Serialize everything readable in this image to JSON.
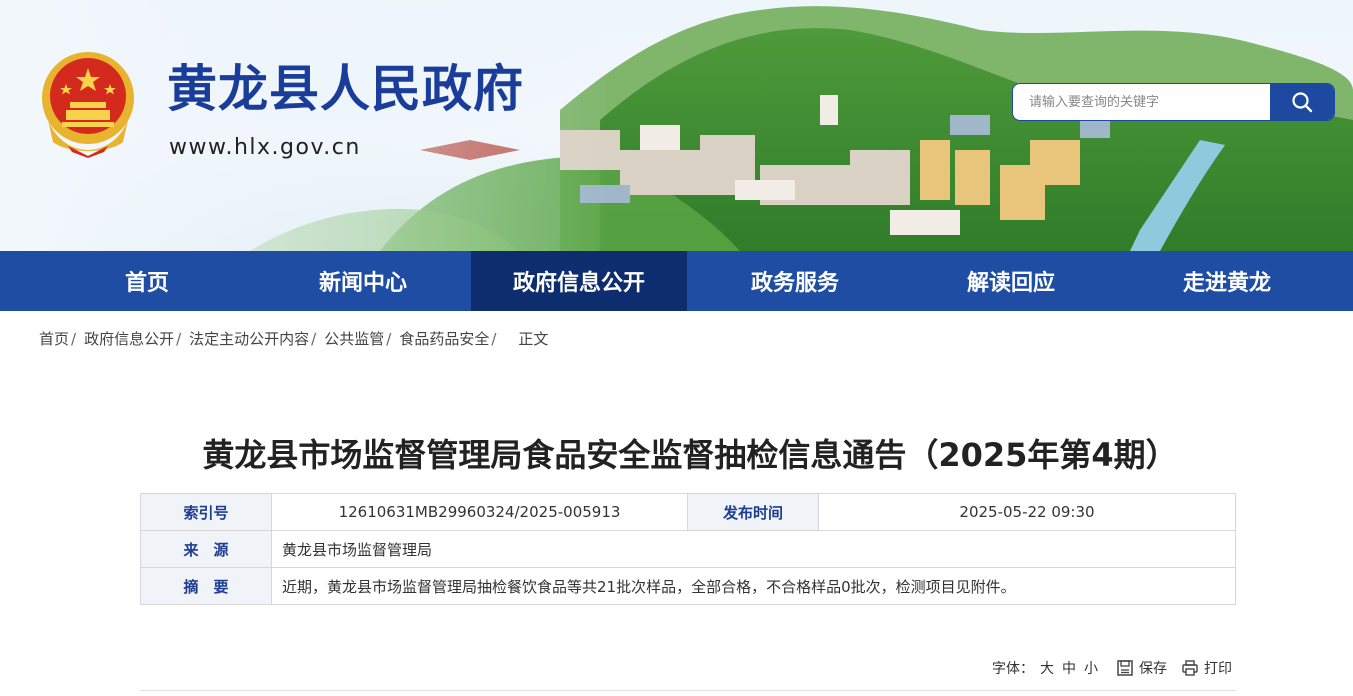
{
  "header": {
    "site_title": "黄龙县人民政府",
    "site_url": "www.hlx.gov.cn",
    "search_placeholder": "请输入要查询的关键字"
  },
  "nav": {
    "items": [
      {
        "label": "首页"
      },
      {
        "label": "新闻中心"
      },
      {
        "label": "政府信息公开"
      },
      {
        "label": "政务服务"
      },
      {
        "label": "解读回应"
      },
      {
        "label": "走进黄龙"
      }
    ],
    "active_index": 2
  },
  "breadcrumb": {
    "items": [
      "首页",
      "政府信息公开",
      "法定主动公开内容",
      "公共监管",
      "食品药品安全"
    ],
    "current": "正文",
    "separator": "/"
  },
  "article": {
    "title": "黄龙县市场监督管理局食品安全监督抽检信息通告（2025年第4期）",
    "meta": {
      "index_label": "索引号",
      "index_value": "12610631MB29960324/2025-005913",
      "date_label": "发布时间",
      "date_value": "2025-05-22 09:30",
      "source_label": "来　源",
      "source_value": "黄龙县市场监督管理局",
      "summary_label": "摘　要",
      "summary_value": "近期，黄龙县市场监督管理局抽检餐饮食品等共21批次样品，全部合格，不合格样品0批次，检测项目见附件。"
    }
  },
  "tools": {
    "font_size_label": "字体：",
    "font_large": "大",
    "font_medium": "中",
    "font_small": "小",
    "save_label": "保存",
    "print_label": "打印"
  },
  "colors": {
    "brand_blue": "#1e4da3",
    "nav_active": "#0d2d6e",
    "title_blue": "#1a3d9a"
  }
}
